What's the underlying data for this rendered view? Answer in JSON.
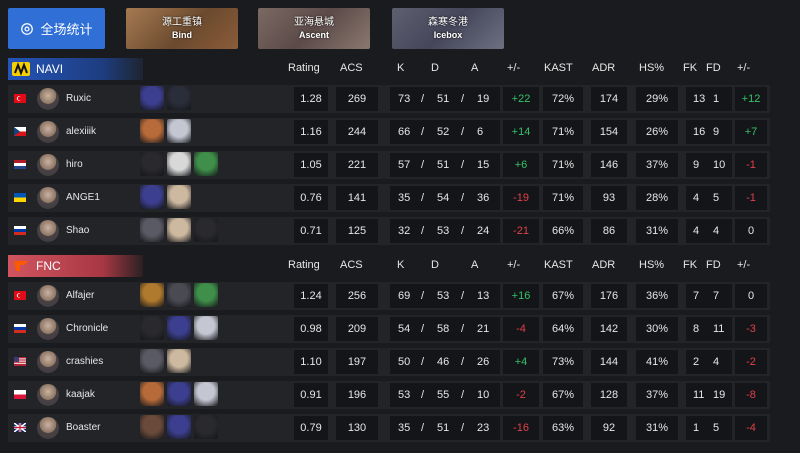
{
  "header": {
    "overall_label": "全场统计",
    "maps": [
      {
        "name_cn": "源工重镇",
        "name_en": "Bind"
      },
      {
        "name_cn": "亚海悬城",
        "name_en": "Ascent"
      },
      {
        "name_cn": "森寒冬港",
        "name_en": "Icebox"
      }
    ]
  },
  "columns": [
    "Rating",
    "ACS",
    "K",
    "D",
    "A",
    "+/-",
    "KAST",
    "ADR",
    "HS%",
    "FK",
    "FD",
    "+/-"
  ],
  "colors": {
    "navi_accent": "#2354b8",
    "fnc_accent": "#d0555f",
    "positive": "#36c16a",
    "negative": "#e0404a",
    "button": "#2f6fd6"
  },
  "teams": [
    {
      "name": "NAVI",
      "players": [
        {
          "name": "Ruxic",
          "flag": "tr",
          "rating": "1.28",
          "acs": "269",
          "k": "73",
          "d": "51",
          "a": "19",
          "pm": "+22",
          "pm_sign": "pos",
          "kast": "72%",
          "adr": "174",
          "hs": "29%",
          "fk": "13",
          "fd": "1",
          "fpm": "+12",
          "fpm_sign": "pos",
          "agents": [
            "#3c3f8f",
            "#2a2d3a"
          ]
        },
        {
          "name": "alexiiik",
          "flag": "cz",
          "rating": "1.16",
          "acs": "244",
          "k": "66",
          "d": "52",
          "a": "6",
          "pm": "+14",
          "pm_sign": "pos",
          "kast": "71%",
          "adr": "154",
          "hs": "26%",
          "fk": "16",
          "fd": "9",
          "fpm": "+7",
          "fpm_sign": "pos",
          "agents": [
            "#b86b3a",
            "#c4c6d2"
          ]
        },
        {
          "name": "hiro",
          "flag": "nl",
          "rating": "1.05",
          "acs": "221",
          "k": "57",
          "d": "51",
          "a": "15",
          "pm": "+6",
          "pm_sign": "pos",
          "kast": "71%",
          "adr": "146",
          "hs": "37%",
          "fk": "9",
          "fd": "10",
          "fpm": "-1",
          "fpm_sign": "neg",
          "agents": [
            "#2a2a2e",
            "#d8d8d8",
            "#3f8f4a"
          ]
        },
        {
          "name": "ANGE1",
          "flag": "ua",
          "rating": "0.76",
          "acs": "141",
          "k": "35",
          "d": "54",
          "a": "36",
          "pm": "-19",
          "pm_sign": "neg",
          "kast": "71%",
          "adr": "93",
          "hs": "28%",
          "fk": "4",
          "fd": "5",
          "fpm": "-1",
          "fpm_sign": "neg",
          "agents": [
            "#3c3f8f",
            "#cdb9a0"
          ]
        },
        {
          "name": "Shao",
          "flag": "ru",
          "rating": "0.71",
          "acs": "125",
          "k": "32",
          "d": "53",
          "a": "24",
          "pm": "-21",
          "pm_sign": "neg",
          "kast": "66%",
          "adr": "86",
          "hs": "31%",
          "fk": "4",
          "fd": "4",
          "fpm": "0",
          "fpm_sign": "neu",
          "agents": [
            "#5a5a64",
            "#cdb9a0",
            "#2a2a2e"
          ]
        }
      ]
    },
    {
      "name": "FNC",
      "players": [
        {
          "name": "Alfajer",
          "flag": "tr",
          "rating": "1.24",
          "acs": "256",
          "k": "69",
          "d": "53",
          "a": "13",
          "pm": "+16",
          "pm_sign": "pos",
          "kast": "67%",
          "adr": "176",
          "hs": "36%",
          "fk": "7",
          "fd": "7",
          "fpm": "0",
          "fpm_sign": "neu",
          "agents": [
            "#b07a2e",
            "#4a4a52",
            "#3f8f4a"
          ]
        },
        {
          "name": "Chronicle",
          "flag": "ru",
          "rating": "0.98",
          "acs": "209",
          "k": "54",
          "d": "58",
          "a": "21",
          "pm": "-4",
          "pm_sign": "neg",
          "kast": "64%",
          "adr": "142",
          "hs": "30%",
          "fk": "8",
          "fd": "11",
          "fpm": "-3",
          "fpm_sign": "neg",
          "agents": [
            "#2a2a2e",
            "#3c3f8f",
            "#c4c6d2"
          ]
        },
        {
          "name": "crashies",
          "flag": "us",
          "rating": "1.10",
          "acs": "197",
          "k": "50",
          "d": "46",
          "a": "26",
          "pm": "+4",
          "pm_sign": "pos",
          "kast": "73%",
          "adr": "144",
          "hs": "41%",
          "fk": "2",
          "fd": "4",
          "fpm": "-2",
          "fpm_sign": "neg",
          "agents": [
            "#5a5a64",
            "#cdb9a0"
          ]
        },
        {
          "name": "kaajak",
          "flag": "pl",
          "rating": "0.91",
          "acs": "196",
          "k": "53",
          "d": "55",
          "a": "10",
          "pm": "-2",
          "pm_sign": "neg",
          "kast": "67%",
          "adr": "128",
          "hs": "37%",
          "fk": "11",
          "fd": "19",
          "fpm": "-8",
          "fpm_sign": "neg",
          "agents": [
            "#b86b3a",
            "#3c3f8f",
            "#c4c6d2"
          ]
        },
        {
          "name": "Boaster",
          "flag": "gb",
          "rating": "0.79",
          "acs": "130",
          "k": "35",
          "d": "51",
          "a": "23",
          "pm": "-16",
          "pm_sign": "neg",
          "kast": "63%",
          "adr": "92",
          "hs": "31%",
          "fk": "1",
          "fd": "5",
          "fpm": "-4",
          "fpm_sign": "neg",
          "agents": [
            "#6a4a3a",
            "#3c3f8f",
            "#2a2a2e"
          ]
        }
      ]
    }
  ]
}
